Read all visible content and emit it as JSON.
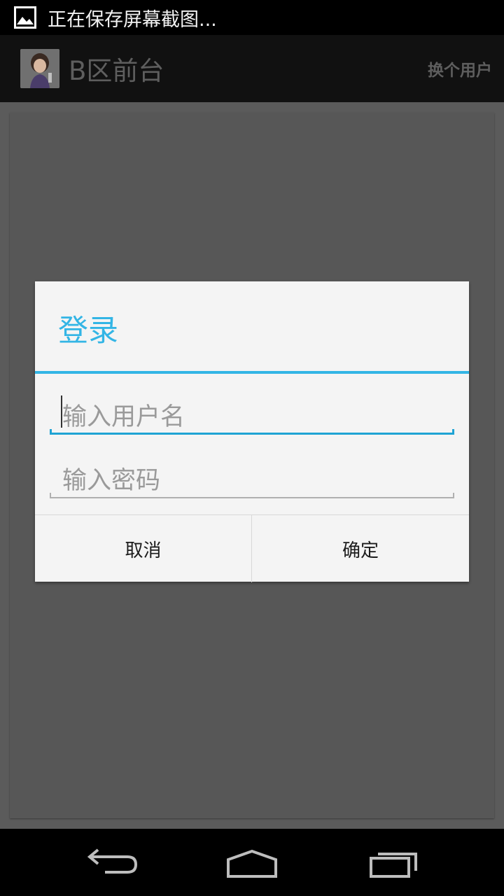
{
  "status_bar": {
    "notification_text": "正在保存屏幕截图..."
  },
  "action_bar": {
    "title": "B区前台",
    "switch_user_label": "换个用户"
  },
  "dialog": {
    "title": "登录",
    "username_placeholder": "输入用户名",
    "password_placeholder": "输入密码",
    "cancel_label": "取消",
    "confirm_label": "确定"
  },
  "colors": {
    "accent": "#33b5e5",
    "focus_underline": "#1fa3d4"
  },
  "icons": {
    "status": "image-icon",
    "nav": [
      "back-icon",
      "home-icon",
      "recent-apps-icon"
    ]
  }
}
